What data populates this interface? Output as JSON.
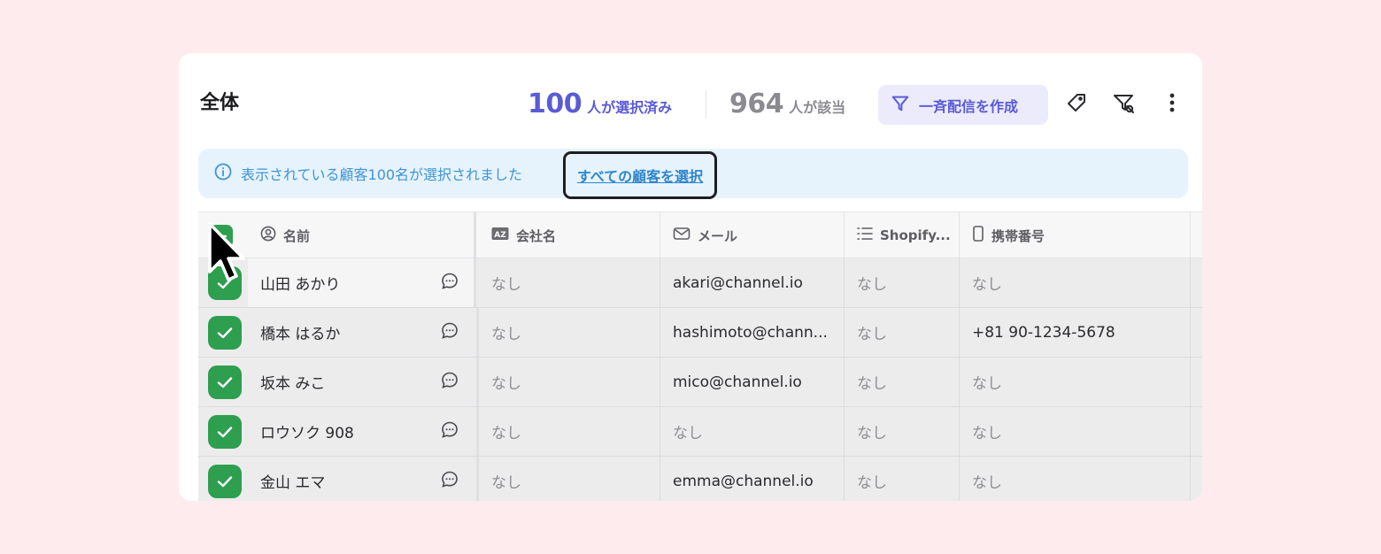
{
  "header": {
    "title": "全体",
    "selected_count": "100",
    "selected_label": "人が選択済み",
    "matched_count": "964",
    "matched_label": "人が該当",
    "bulk_message_label": "一斉配信を作成"
  },
  "banner": {
    "message": "表示されている顧客100名が選択されました",
    "select_all_link": "すべての顧客を選択"
  },
  "columns": {
    "name": "名前",
    "company": "会社名",
    "email": "メール",
    "shopify": "Shopify...",
    "mobile": "携帯番号"
  },
  "rows": [
    {
      "name": "山田 あかり",
      "company": "なし",
      "email": "akari@channel.io",
      "shopify": "なし",
      "mobile": "なし"
    },
    {
      "name": "橋本 はるか",
      "company": "なし",
      "email": "hashimoto@chann...",
      "shopify": "なし",
      "mobile": "+81 90-1234-5678"
    },
    {
      "name": "坂本 みこ",
      "company": "なし",
      "email": "mico@channel.io",
      "shopify": "なし",
      "mobile": "なし"
    },
    {
      "name": "ロウソク 908",
      "company": "なし",
      "email": "なし",
      "shopify": "なし",
      "mobile": "なし"
    },
    {
      "name": "金山 エマ",
      "company": "なし",
      "email": "emma@channel.io",
      "shopify": "なし",
      "mobile": "なし"
    }
  ],
  "colors": {
    "accent": "#5b5bd6",
    "check_green": "#2e9e4f",
    "banner_bg": "#e6f3fc",
    "banner_text": "#3e94d6"
  },
  "icons": {
    "bulk": "send-icon",
    "tag": "tag-icon",
    "filter": "filter-icon",
    "more": "more-vertical-icon",
    "info": "info-icon",
    "user": "user-circle-icon",
    "company": "az-icon",
    "mail": "mail-icon",
    "list": "list-icon",
    "phone": "phone-icon",
    "chat": "chat-icon",
    "check": "check-icon"
  }
}
